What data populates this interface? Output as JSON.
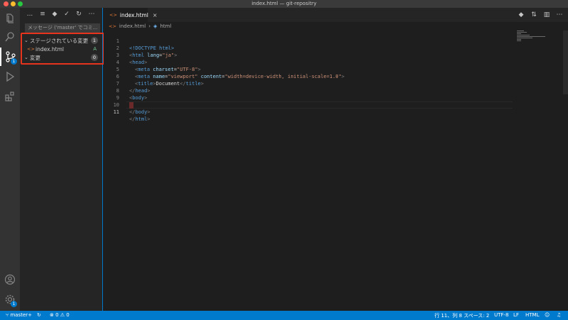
{
  "window": {
    "title": "index.html — git-repositry"
  },
  "activity_bar": {
    "scm_badge": "1",
    "settings_badge": "1"
  },
  "sidebar": {
    "more_label": "...",
    "commit_placeholder": "メッセージ ('master' でコミ...",
    "staged_section": {
      "label": "ステージされている変更",
      "count": "1"
    },
    "staged_file": {
      "name": "index.html",
      "status": "A"
    },
    "changes_section": {
      "label": "変更",
      "count": "0"
    }
  },
  "editor": {
    "tab_label": "index.html",
    "breadcrumb": {
      "file": "index.html",
      "symbol": "html"
    },
    "lines": [
      {
        "n": "1"
      },
      {
        "n": "2"
      },
      {
        "n": "3"
      },
      {
        "n": "4"
      },
      {
        "n": "5"
      },
      {
        "n": "6"
      },
      {
        "n": "7"
      },
      {
        "n": "8"
      },
      {
        "n": "9"
      },
      {
        "n": "10"
      },
      {
        "n": "11"
      }
    ],
    "code": {
      "doctype": "<!DOCTYPE html>",
      "html_open_tag": "html",
      "lang_attr": "lang",
      "lang_val": "\"ja\"",
      "head_open": "head",
      "meta": "meta",
      "charset_attr": "charset",
      "charset_val": "\"UTF-8\"",
      "name_attr": "name",
      "name_val": "\"viewport\"",
      "content_attr": "content",
      "content_val": "\"width=device-width, initial-scale=1.0\"",
      "title_tag": "title",
      "title_text": "Document",
      "head_close": "head",
      "body_open": "body",
      "body_close": "body",
      "html_close": "html"
    }
  },
  "statusbar": {
    "branch": "master+",
    "errors": "0",
    "warnings": "0",
    "position": "行 11、列 8",
    "spaces": "スペース: 2",
    "encoding": "UTF-8",
    "eol": "LF",
    "language": "HTML"
  },
  "colors": {
    "accent": "#007acc",
    "highlight_box": "#e8341c"
  }
}
